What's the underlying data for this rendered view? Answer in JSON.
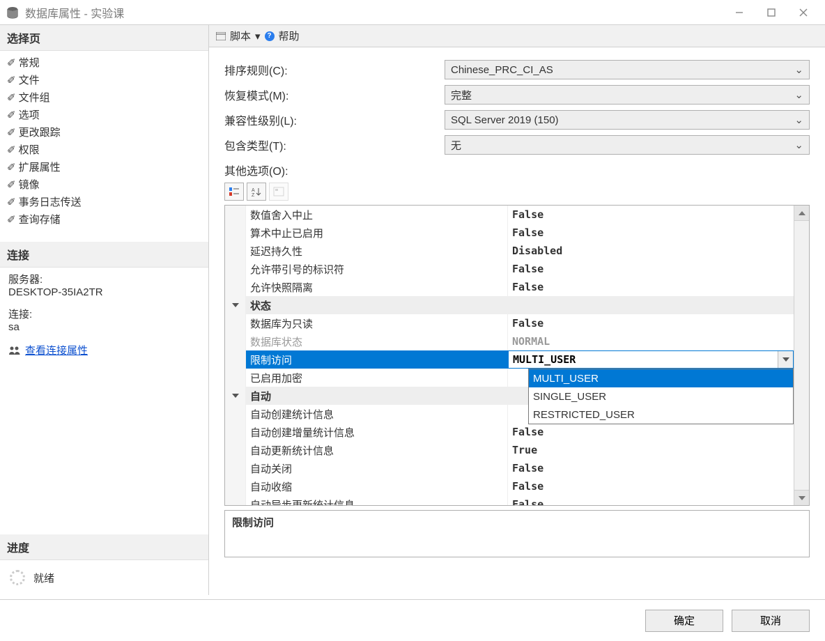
{
  "window": {
    "title": "数据库属性 - 实验课"
  },
  "sidebar": {
    "select_page_head": "选择页",
    "items": [
      {
        "label": "常规"
      },
      {
        "label": "文件"
      },
      {
        "label": "文件组"
      },
      {
        "label": "选项"
      },
      {
        "label": "更改跟踪"
      },
      {
        "label": "权限"
      },
      {
        "label": "扩展属性"
      },
      {
        "label": "镜像"
      },
      {
        "label": "事务日志传送"
      },
      {
        "label": "查询存储"
      }
    ],
    "connection_head": "连接",
    "server_label": "服务器:",
    "server_value": "DESKTOP-35IA2TR",
    "conn_label": "连接:",
    "conn_value": "sa",
    "view_conn_link": "查看连接属性",
    "progress_head": "进度",
    "progress_label": "就绪"
  },
  "toolbar": {
    "script": "脚本",
    "help": "帮助"
  },
  "form": {
    "collation_label": "排序规则(C):",
    "collation_value": "Chinese_PRC_CI_AS",
    "recovery_label": "恢复模式(M):",
    "recovery_value": "完整",
    "compat_label": "兼容性级别(L):",
    "compat_value": "SQL Server 2019 (150)",
    "contain_label": "包含类型(T):",
    "contain_value": "无",
    "other_label": "其他选项(O):"
  },
  "grid": {
    "rows": [
      {
        "label": "数值舍入中止",
        "value": "False"
      },
      {
        "label": "算术中止已启用",
        "value": "False"
      },
      {
        "label": "延迟持久性",
        "value": "Disabled"
      },
      {
        "label": "允许带引号的标识符",
        "value": "False"
      },
      {
        "label": "允许快照隔离",
        "value": "False"
      }
    ],
    "group_status": "状态",
    "status_rows": [
      {
        "label": "数据库为只读",
        "value": "False"
      },
      {
        "label": "数据库状态",
        "value": "NORMAL",
        "disabled": true
      },
      {
        "label": "限制访问",
        "value": "MULTI_USER",
        "selected": true
      },
      {
        "label": "已启用加密",
        "value": ""
      }
    ],
    "group_auto": "自动",
    "auto_rows": [
      {
        "label": "自动创建统计信息",
        "value": ""
      },
      {
        "label": "自动创建增量统计信息",
        "value": "False"
      },
      {
        "label": "自动更新统计信息",
        "value": "True"
      },
      {
        "label": "自动关闭",
        "value": "False"
      },
      {
        "label": "自动收缩",
        "value": "False"
      },
      {
        "label": "自动异步更新统计信息",
        "value": "False"
      }
    ]
  },
  "dropdown": {
    "opts": [
      {
        "label": "MULTI_USER",
        "sel": true
      },
      {
        "label": "SINGLE_USER"
      },
      {
        "label": "RESTRICTED_USER"
      }
    ]
  },
  "desc": {
    "title": "限制访问"
  },
  "footer": {
    "ok": "确定",
    "cancel": "取消"
  }
}
